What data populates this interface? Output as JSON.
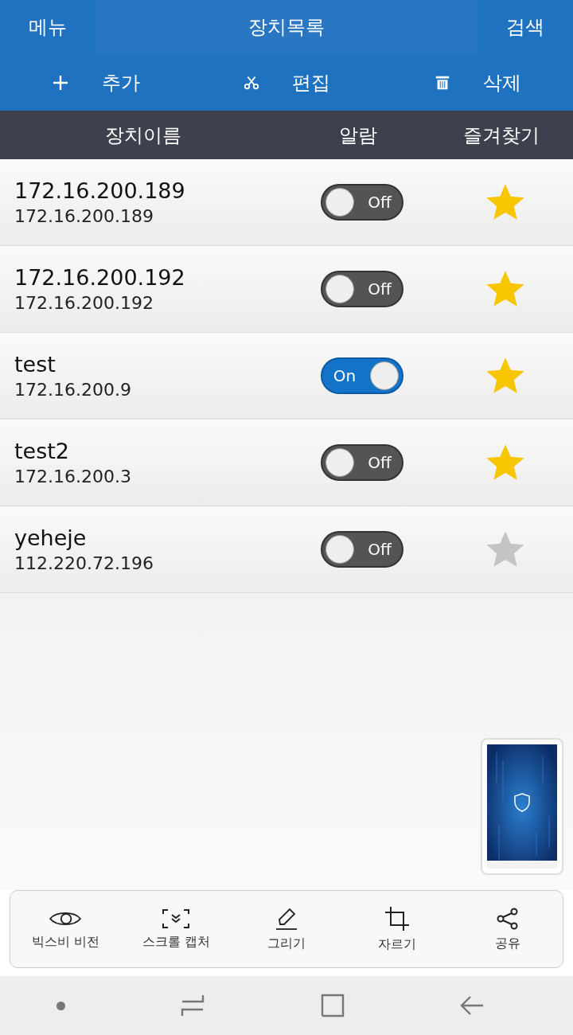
{
  "header": {
    "menu": "메뉴",
    "title": "장치목록",
    "search": "검색"
  },
  "toolbar": [
    {
      "kind": "add",
      "label": "추가"
    },
    {
      "kind": "edit",
      "label": "편집"
    },
    {
      "kind": "delete",
      "label": "삭제"
    }
  ],
  "columns": [
    "장치이름",
    "알람",
    "즐겨찾기"
  ],
  "devices": [
    {
      "name": "172.16.200.189",
      "ip": "172.16.200.189",
      "alarm": false,
      "alarm_label": "Off",
      "favorite": true
    },
    {
      "name": "172.16.200.192",
      "ip": "172.16.200.192",
      "alarm": false,
      "alarm_label": "Off",
      "favorite": true
    },
    {
      "name": "test",
      "ip": "172.16.200.9",
      "alarm": true,
      "alarm_label": "On",
      "favorite": true
    },
    {
      "name": "test2",
      "ip": "172.16.200.3",
      "alarm": false,
      "alarm_label": "Off",
      "favorite": true
    },
    {
      "name": "yeheje",
      "ip": "112.220.72.196",
      "alarm": false,
      "alarm_label": "Off",
      "favorite": false
    }
  ],
  "capture_bar": [
    {
      "kind": "eye",
      "label": "빅스비 비전"
    },
    {
      "kind": "scroll",
      "label": "스크롤 캡처"
    },
    {
      "kind": "pen",
      "label": "그리기"
    },
    {
      "kind": "crop",
      "label": "자르기"
    },
    {
      "kind": "share",
      "label": "공유"
    }
  ]
}
